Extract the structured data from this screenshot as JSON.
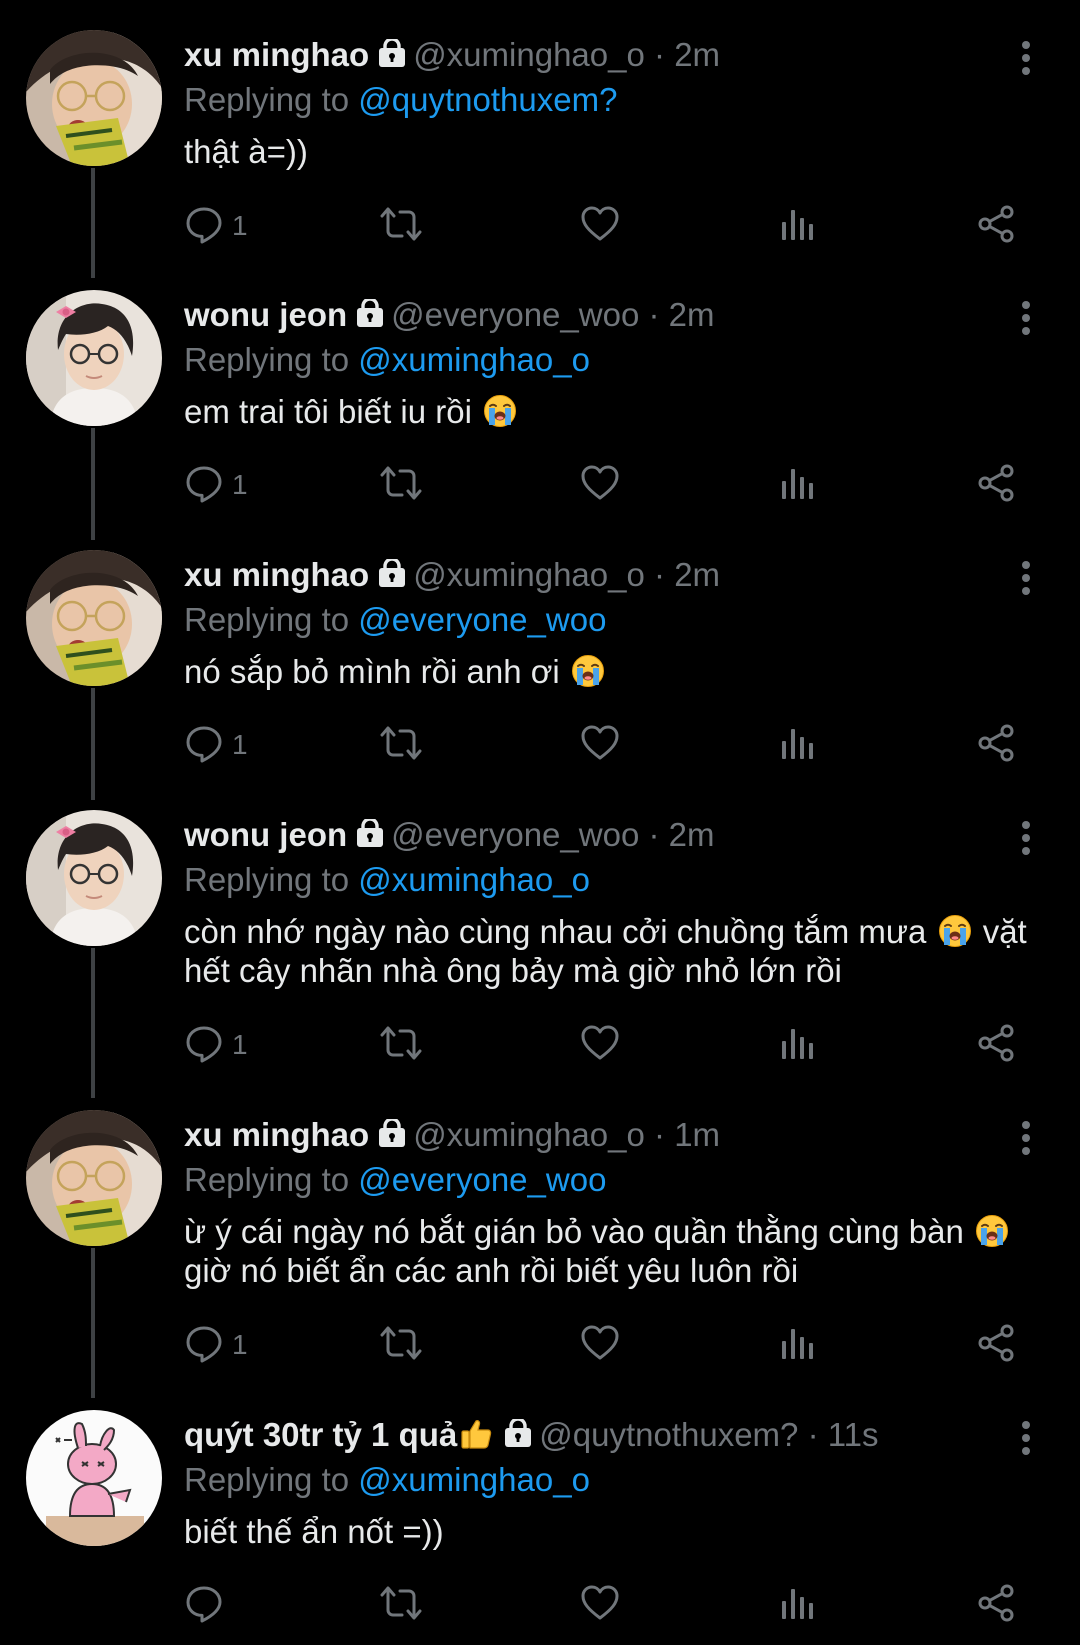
{
  "replying_prefix": "Replying to",
  "dot": "·",
  "colors": {
    "background": "#000000",
    "text": "#e7e9ea",
    "muted": "#71767b",
    "mention": "#1d9bf0",
    "line": "#3e4144"
  },
  "tweets": [
    {
      "name": "xu minghao",
      "handle": "@xuminghao_o",
      "time": "2m",
      "reply_to": "@quytnothuxem?",
      "text": "thật à=))",
      "reply_count": "1",
      "avatar": "avatar-minghao",
      "protected": true
    },
    {
      "name": "wonu jeon",
      "handle": "@everyone_woo",
      "time": "2m",
      "reply_to": "@xuminghao_o",
      "text": "em trai tôi biết iu rồi",
      "emoji": "loudly-crying-face",
      "reply_count": "1",
      "avatar": "avatar-wonu",
      "protected": true
    },
    {
      "name": "xu minghao",
      "handle": "@xuminghao_o",
      "time": "2m",
      "reply_to": "@everyone_woo",
      "text": "nó sắp bỏ mình rồi anh ơi",
      "emoji": "loudly-crying-face",
      "reply_count": "1",
      "avatar": "avatar-minghao",
      "protected": true
    },
    {
      "name": "wonu jeon",
      "handle": "@everyone_woo",
      "time": "2m",
      "reply_to": "@xuminghao_o",
      "text_before": "còn nhớ ngày nào cùng nhau cởi chuồng tắm mưa",
      "text_after": "vặt hết cây nhãn nhà ông bảy mà giờ nhỏ lớn rồi",
      "emoji": "loudly-crying-face",
      "reply_count": "1",
      "avatar": "avatar-wonu",
      "protected": true
    },
    {
      "name": "xu minghao",
      "handle": "@xuminghao_o",
      "time": "1m",
      "reply_to": "@everyone_woo",
      "text_before": "ừ ý cái ngày nó bắt gián bỏ vào quần thằng cùng bàn",
      "text_after": "giờ nó biết ẩn các anh rồi biết yêu luôn rồi",
      "emoji": "loudly-crying-face",
      "reply_count": "1",
      "avatar": "avatar-minghao",
      "protected": true
    },
    {
      "name": "quýt 30tr tỷ 1 quả",
      "name_emoji": "thumbs-up",
      "handle": "@quytnothuxem?",
      "time": "11s",
      "reply_to": "@xuminghao_o",
      "text": "biết thế ẩn nốt =))",
      "reply_count": "",
      "avatar": "avatar-quyt",
      "protected": true
    }
  ]
}
